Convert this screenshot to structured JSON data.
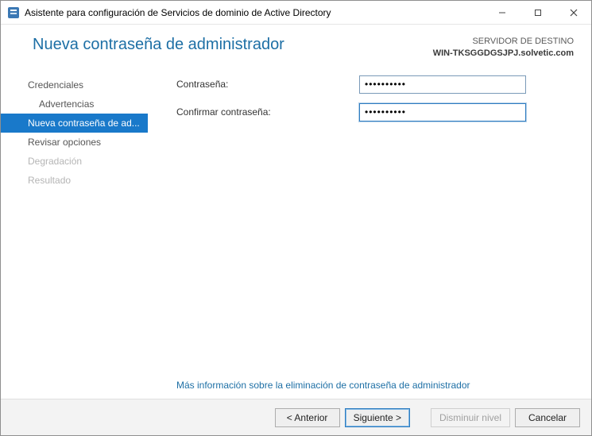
{
  "window": {
    "title": "Asistente para configuración de Servicios de dominio de Active Directory"
  },
  "header": {
    "title": "Nueva contraseña de administrador",
    "target_label": "SERVIDOR DE DESTINO",
    "target_host": "WIN-TKSGGDGSJPJ.solvetic.com"
  },
  "sidebar": {
    "items": [
      {
        "label": "Credenciales",
        "state": "normal"
      },
      {
        "label": "Advertencias",
        "state": "sub"
      },
      {
        "label": "Nueva contraseña de ad...",
        "state": "selected"
      },
      {
        "label": "Revisar opciones",
        "state": "normal"
      },
      {
        "label": "Degradación",
        "state": "disabled"
      },
      {
        "label": "Resultado",
        "state": "disabled"
      }
    ]
  },
  "form": {
    "password_label": "Contraseña:",
    "confirm_label": "Confirmar contraseña:",
    "password_value": "••••••••••",
    "confirm_value": "••••••••••"
  },
  "link": {
    "more": "Más información sobre la eliminación de contraseña de administrador"
  },
  "footer": {
    "prev": "< Anterior",
    "next": "Siguiente >",
    "demote": "Disminuir nivel",
    "cancel": "Cancelar"
  }
}
